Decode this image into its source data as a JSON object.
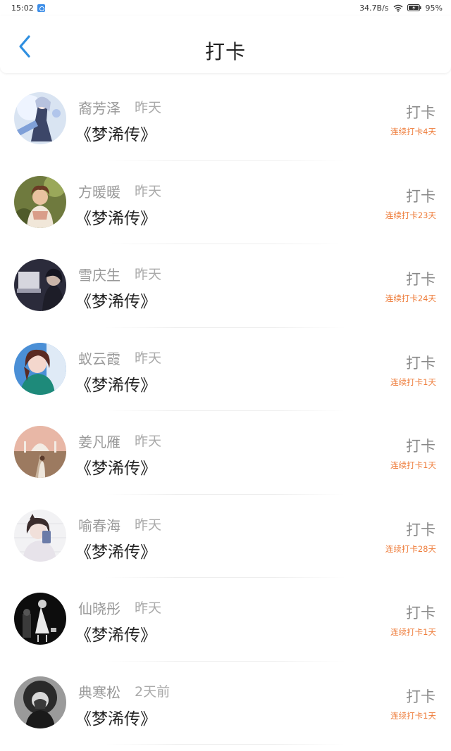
{
  "status_bar": {
    "time": "15:02",
    "network_speed": "34.7B/s",
    "battery": "95%"
  },
  "header": {
    "title": "打卡"
  },
  "feed": [
    {
      "name": "裔芳泽",
      "time": "昨天",
      "book": "《梦浠传》",
      "action": "打卡",
      "streak": "连续打卡4天"
    },
    {
      "name": "方暖暖",
      "time": "昨天",
      "book": "《梦浠传》",
      "action": "打卡",
      "streak": "连续打卡23天"
    },
    {
      "name": "雪庆生",
      "time": "昨天",
      "book": "《梦浠传》",
      "action": "打卡",
      "streak": "连续打卡24天"
    },
    {
      "name": "蚁云霞",
      "time": "昨天",
      "book": "《梦浠传》",
      "action": "打卡",
      "streak": "连续打卡1天"
    },
    {
      "name": "姜凡雁",
      "time": "昨天",
      "book": "《梦浠传》",
      "action": "打卡",
      "streak": "连续打卡1天"
    },
    {
      "name": "喻春海",
      "time": "昨天",
      "book": "《梦浠传》",
      "action": "打卡",
      "streak": "连续打卡28天"
    },
    {
      "name": "仙晓彤",
      "time": "昨天",
      "book": "《梦浠传》",
      "action": "打卡",
      "streak": "连续打卡1天"
    },
    {
      "name": "典寒松",
      "time": "2天前",
      "book": "《梦浠传》",
      "action": "打卡",
      "streak": "连续打卡1天"
    }
  ],
  "colors": {
    "accent_blue": "#2f8fe0",
    "streak_orange": "#ee7c3a"
  },
  "icons": {
    "back": "chevron-left-icon",
    "wifi": "wifi-icon",
    "battery": "battery-icon"
  }
}
